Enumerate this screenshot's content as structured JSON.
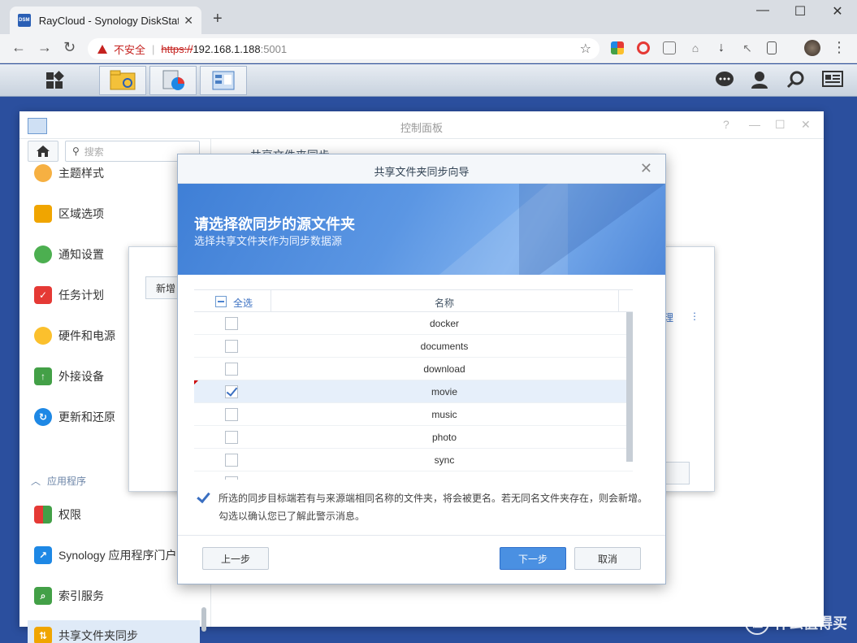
{
  "browser": {
    "tab_title": "RayCloud - Synology DiskStati",
    "tab_favicon": "DSM",
    "new_tab": "+",
    "minimize": "—",
    "maximize": "☐",
    "close": "✕",
    "insecure_label": "不安全",
    "url_scheme": "https://",
    "url_host": "192.168.1.188",
    "url_port": ":5001"
  },
  "control_panel": {
    "title": "控制面板",
    "search_placeholder": "搜索",
    "main_header": "共享文件夹同步",
    "sidebar": {
      "items": [
        {
          "label": "主题样式",
          "color": "#e8a23a"
        },
        {
          "label": "区域选项",
          "color": "#f0a500"
        },
        {
          "label": "通知设置",
          "color": "#4caf50"
        },
        {
          "label": "任务计划",
          "color": "#e53935"
        },
        {
          "label": "硬件和电源",
          "color": "#fbc02d"
        },
        {
          "label": "外接设备",
          "color": "#43a047"
        },
        {
          "label": "更新和还原",
          "color": "#1e88e5"
        }
      ],
      "section": "应用程序",
      "app_items": [
        {
          "label": "权限",
          "color": "#e53935"
        },
        {
          "label": "Synology 应用程序门户",
          "color": "#1e88e5"
        },
        {
          "label": "索引服务",
          "color": "#43a047"
        },
        {
          "label": "共享文件夹同步",
          "color": "#f0a500"
        }
      ]
    }
  },
  "background_dialog": {
    "new_button": "新增",
    "manage_link": "理",
    "more_link": "⋮"
  },
  "wizard": {
    "title": "共享文件夹同步向导",
    "heading": "请选择欲同步的源文件夹",
    "subheading": "选择共享文件夹作为同步数据源",
    "select_all": "全选",
    "column_name": "名称",
    "folders": [
      {
        "name": "docker",
        "checked": false
      },
      {
        "name": "documents",
        "checked": false
      },
      {
        "name": "download",
        "checked": false
      },
      {
        "name": "movie",
        "checked": true
      },
      {
        "name": "music",
        "checked": false
      },
      {
        "name": "photo",
        "checked": false
      },
      {
        "name": "sync",
        "checked": false
      }
    ],
    "confirm_text": "所选的同步目标端若有与来源端相同名称的文件夹，将会被更名。若无同名文件夹存在，则会新增。勾选以确认您已了解此警示消息。",
    "confirm_checked": true,
    "back_button": "上一步",
    "next_button": "下一步",
    "cancel_button": "取消"
  },
  "watermark": {
    "badge": "值",
    "text": "什么值得买"
  }
}
